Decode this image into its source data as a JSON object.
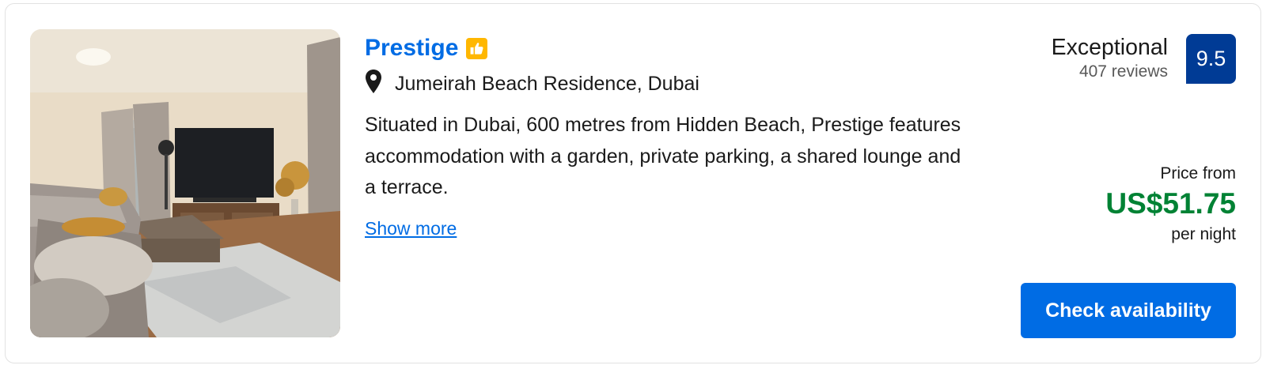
{
  "property": {
    "name": "Prestige",
    "badge_icon": "thumbs-up-icon",
    "location_icon": "map-pin-icon",
    "location": "Jumeirah Beach Residence, Dubai",
    "description": "Situated in Dubai, 600 metres from Hidden Beach, Prestige features accommodation with a garden, private parking, a shared lounge and a terrace.",
    "show_more": "Show more",
    "photo_icon": "living-room-photo"
  },
  "review": {
    "word": "Exceptional",
    "count": "407 reviews",
    "score": "9.5"
  },
  "price": {
    "label": "Price from",
    "value": "US$51.75",
    "unit": "per night"
  },
  "cta": {
    "label": "Check availability"
  },
  "colors": {
    "link_blue": "#006ce4",
    "badge_yellow": "#ffb700",
    "score_navy": "#003b95",
    "price_green": "#008234"
  }
}
